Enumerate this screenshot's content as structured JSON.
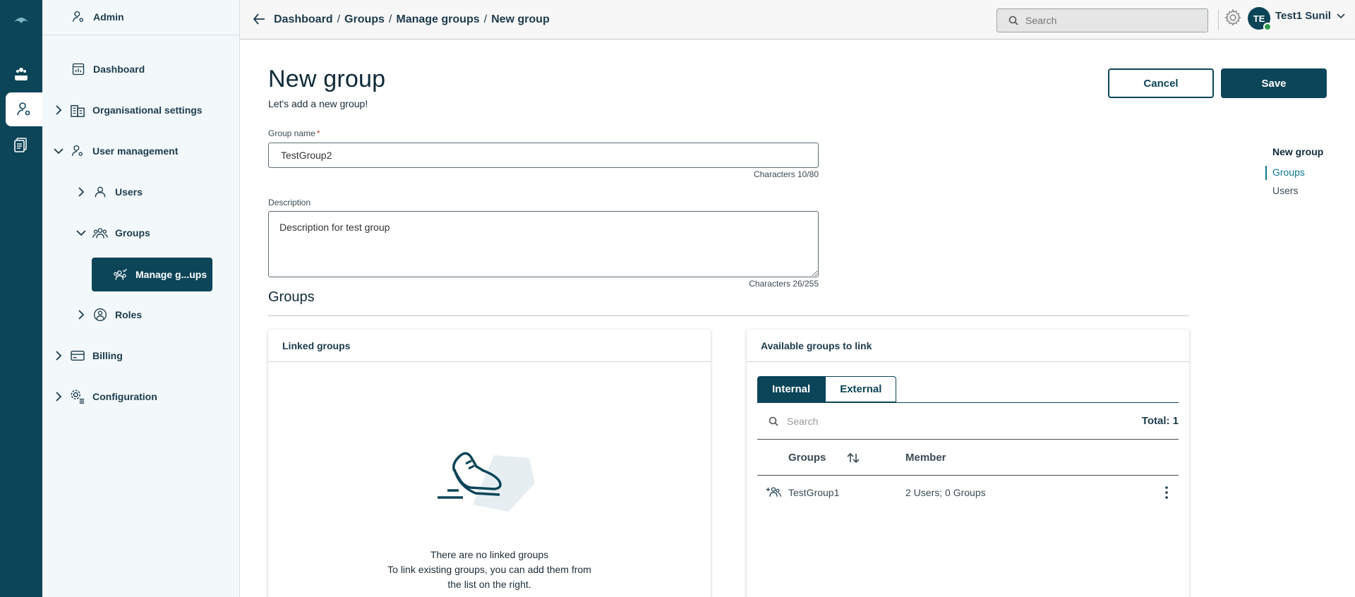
{
  "sidebar": {
    "header": "Admin",
    "items": [
      {
        "label": "Dashboard",
        "icon": "dashboard-icon"
      },
      {
        "label": "Organisational settings",
        "icon": "building-icon"
      },
      {
        "label": "User management",
        "icon": "user-settings-icon"
      },
      {
        "label": "Users",
        "icon": "user-icon"
      },
      {
        "label": "Groups",
        "icon": "group-icon"
      },
      {
        "label": "Manage g...ups",
        "icon": "manage-groups-icon"
      },
      {
        "label": "Roles",
        "icon": "role-icon"
      },
      {
        "label": "Billing",
        "icon": "card-icon"
      },
      {
        "label": "Configuration",
        "icon": "gear-list-icon"
      }
    ]
  },
  "breadcrumb": [
    "Dashboard",
    "Groups",
    "Manage groups",
    "New group"
  ],
  "topbar": {
    "search_placeholder": "Search",
    "user_initials": "TE",
    "user_name": "Test1 Sunil"
  },
  "page": {
    "title": "New group",
    "subtitle": "Let's add a new group!",
    "cancel_label": "Cancel",
    "save_label": "Save"
  },
  "form": {
    "group_name_label": "Group name",
    "required_mark": "*",
    "group_name_value": "TestGroup2",
    "group_name_count": "Characters 10/80",
    "description_label": "Description",
    "description_value": "Description for test group",
    "description_count": "Characters 26/255"
  },
  "groups_section": {
    "title": "Groups",
    "linked": {
      "header": "Linked groups",
      "empty_title": "There are no linked groups",
      "empty_line2": "To link existing groups, you can add them from",
      "empty_line3": "the list on the right."
    },
    "available": {
      "header": "Available groups to link",
      "tabs": [
        "Internal",
        "External"
      ],
      "search_placeholder": "Search",
      "total": "Total: 1",
      "columns": [
        "Groups",
        "Member"
      ],
      "rows": [
        {
          "name": "TestGroup1",
          "member": "2 Users; 0 Groups"
        }
      ]
    }
  },
  "right_nav": {
    "title": "New group",
    "items": [
      "Groups",
      "Users"
    ]
  },
  "colors": {
    "brand": "#0c4458",
    "accent_link": "#0b7796",
    "status_online": "#2e9a46"
  }
}
